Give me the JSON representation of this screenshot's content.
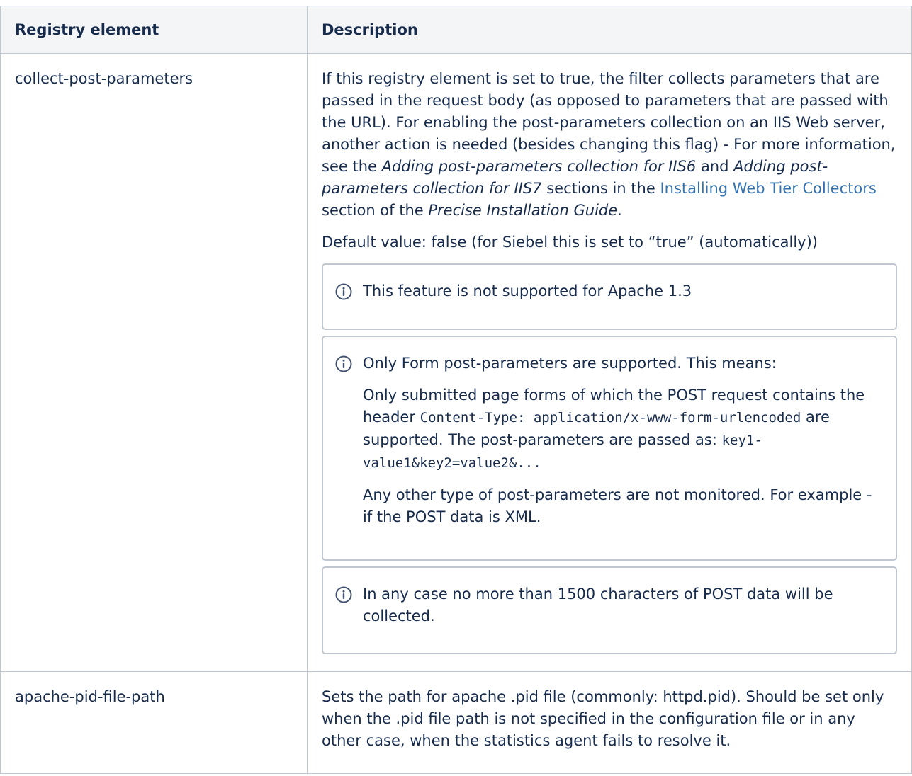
{
  "table": {
    "headers": [
      "Registry element",
      "Description"
    ],
    "rows": [
      {
        "name": "collect-post-parameters",
        "desc": {
          "part1": "If this registry element is set to true, the filter collects parameters that are passed in the request body (as opposed to parameters that are passed with the URL). For enabling the post-parameters collection on an IIS Web server, another action is needed (besides changing this flag) - For more information, see the ",
          "em1": "Adding post-parameters collection for IIS6",
          "part2": " and ",
          "em2": "Adding post-parameters collection for IIS7",
          "part3": " sections in the ",
          "link": "Installing Web Tier Collectors",
          "part4": " section of the ",
          "em3": "Precise Installation Guide",
          "part5": "."
        },
        "default_value": "Default value: false (for Siebel this is set to “true” (automatically))",
        "notes": [
          {
            "icon": "info-icon",
            "text": "This feature is not supported for Apache 1.3"
          },
          {
            "icon": "info-icon",
            "text": "Only Form post-parameters are supported. This means:",
            "detail_part1": "Only submitted page forms of which the POST request contains the header ",
            "detail_code1": "Content-Type: application/x-www-form-urlencoded",
            "detail_part2": " are supported. The post-parameters are passed as: ",
            "detail_code2": "key1-value1&key2=value2&...",
            "extra": "Any other type of post-parameters are not monitored. For example - if the POST data is XML."
          },
          {
            "icon": "info-icon",
            "text": "In any case no more than 1500 characters of POST data will be collected."
          }
        ]
      },
      {
        "name": "apache-pid-file-path",
        "desc_text": "Sets the path for apache .pid file (commonly: httpd.pid). Should be set only when the .pid file path is not specified in the configuration file or in any other case, when the statistics agent fails to resolve it."
      }
    ]
  }
}
